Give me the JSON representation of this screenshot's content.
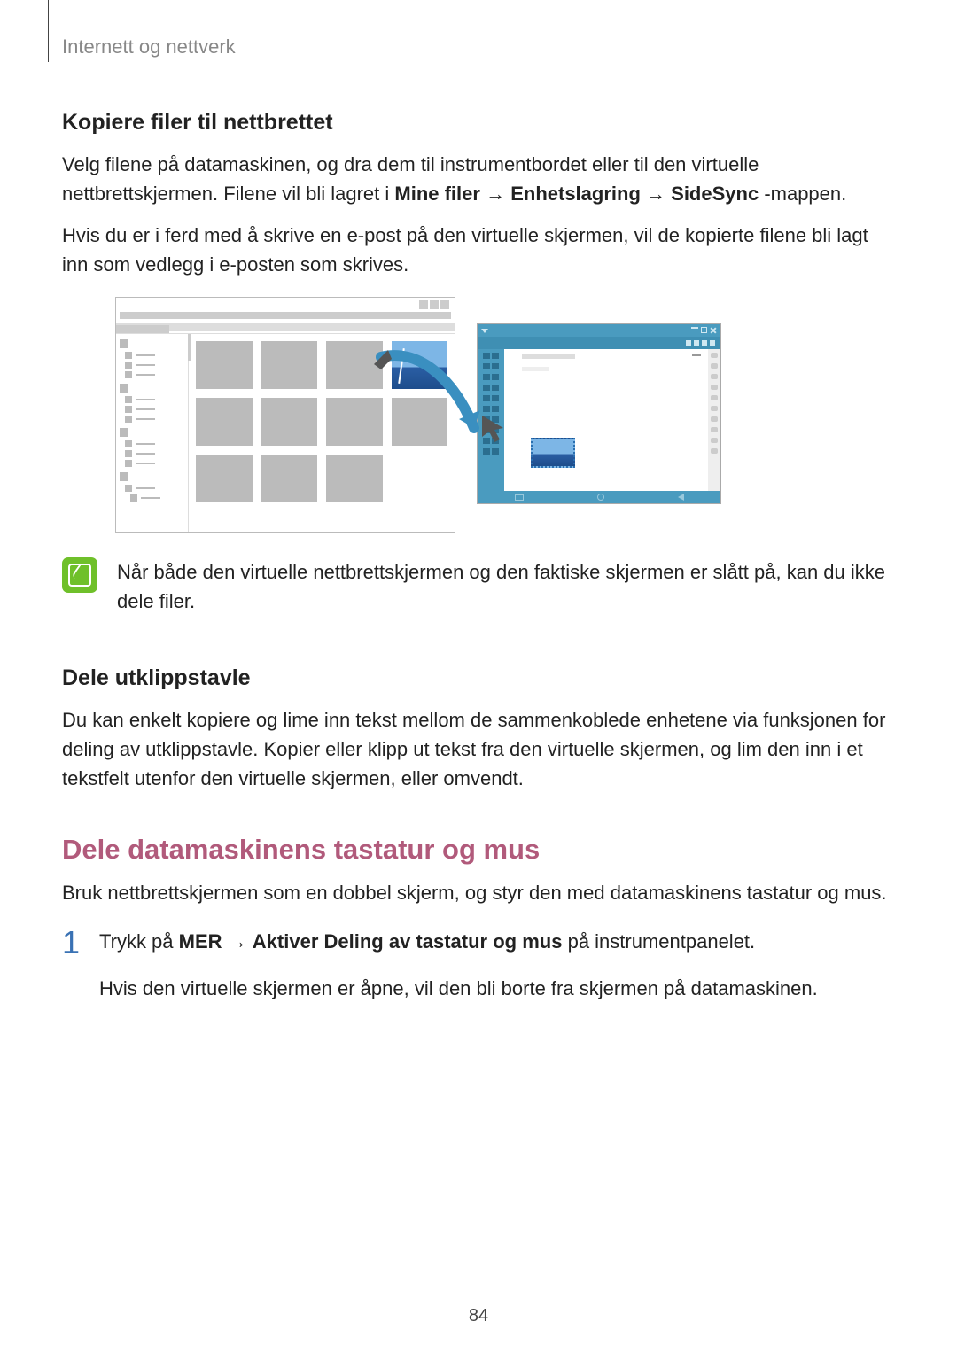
{
  "breadcrumb": "Internett og nettverk",
  "h_copy": "Kopiere filer til nettbrettet",
  "p_copy_1a": "Velg filene på datamaskinen, og dra dem til instrumentbordet eller til den virtuelle nettbrettskjermen. Filene vil bli lagret i ",
  "b_mine_filer": "Mine filer",
  "arrow": " → ",
  "b_enhets": "Enhetslagring",
  "b_sidesync": "SideSync",
  "p_copy_1b": "-mappen.",
  "p_copy_2": "Hvis du er i ferd med å skrive en e-post på den virtuelle skjermen, vil de kopierte filene bli lagt inn som vedlegg i e-posten som skrives.",
  "note": "Når både den virtuelle nettbrettskjermen og den faktiske skjermen er slått på, kan du ikke dele filer.",
  "h_clip": "Dele utklippstavle",
  "p_clip": "Du kan enkelt kopiere og lime inn tekst mellom de sammenkoblede enhetene via funksjonen for deling av utklippstavle. Kopier eller klipp ut tekst fra den virtuelle skjermen, og lim den inn i et tekstfelt utenfor den virtuelle skjermen, eller omvendt.",
  "h_kbm": "Dele datamaskinens tastatur og mus",
  "p_kbm": "Bruk nettbrettskjermen som en dobbel skjerm, og styr den med datamaskinens tastatur og mus.",
  "step1_num": "1",
  "step1_a": "Trykk på ",
  "b_mer": "MER",
  "b_aktiver": "Aktiver Deling av tastatur og mus",
  "step1_b": " på instrumentpanelet.",
  "step1_sub": "Hvis den virtuelle skjermen er åpne, vil den bli borte fra skjermen på datamaskinen.",
  "page_number": "84"
}
